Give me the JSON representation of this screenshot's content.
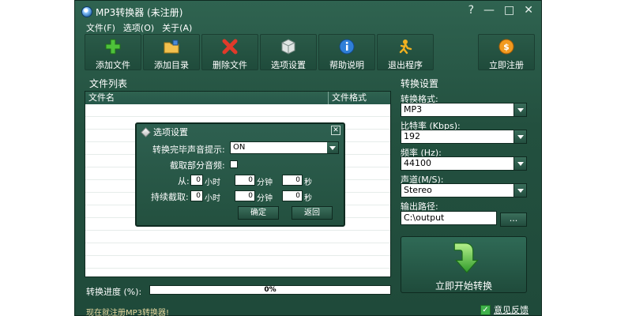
{
  "window": {
    "title": "MP3转换器 (未注册)",
    "controls": [
      "?",
      "—",
      "□",
      "✕"
    ]
  },
  "menu": [
    "文件(F)",
    "选项(O)",
    "关于(A)"
  ],
  "toolbar": [
    {
      "label": "添加文件",
      "icon": "plus-icon"
    },
    {
      "label": "添加目录",
      "icon": "folder-icon"
    },
    {
      "label": "删除文件",
      "icon": "delete-icon"
    },
    {
      "label": "选项设置",
      "icon": "cube-icon"
    },
    {
      "label": "帮助说明",
      "icon": "info-icon"
    },
    {
      "label": "退出程序",
      "icon": "exit-icon"
    },
    {
      "label": "立即注册",
      "icon": "coin-icon"
    }
  ],
  "file_list": {
    "title": "文件列表",
    "columns": [
      "文件名",
      "文件格式"
    ],
    "rows": []
  },
  "settings": {
    "title": "转换设置",
    "format_label": "转换格式:",
    "format_value": "MP3",
    "bitrate_label": "比特率 (Kbps):",
    "bitrate_value": "192",
    "frequency_label": "频率 (Hz):",
    "frequency_value": "44100",
    "channel_label": "声道(M/S):",
    "channel_value": "Stereo",
    "output_label": "输出路径:",
    "output_value": "C:\\output",
    "browse_label": "...",
    "start_label": "立即开始转换"
  },
  "progress": {
    "label": "转换进度 (%):",
    "value": 0,
    "text": "0%"
  },
  "footer": {
    "register_link": "现在就注册MP3转换器!",
    "feedback": "意见反馈"
  },
  "dialog": {
    "title": "选项设置",
    "prompt_label": "转换完毕声音提示:",
    "prompt_value": "ON",
    "clip_label": "截取部分音频:",
    "from_label": "从:",
    "duration_label": "持续截取:",
    "from": {
      "hours": "0",
      "minutes": "0",
      "seconds": "0"
    },
    "duration": {
      "hours": "0",
      "minutes": "0",
      "seconds": "0"
    },
    "unit_hour": "小时",
    "unit_minute": "分钟",
    "unit_second": "秒",
    "ok_label": "确定",
    "back_label": "返回"
  },
  "colors": {
    "window_bg": "#23503f",
    "border": "#0f2a20",
    "accent_green": "#3fb24b"
  }
}
